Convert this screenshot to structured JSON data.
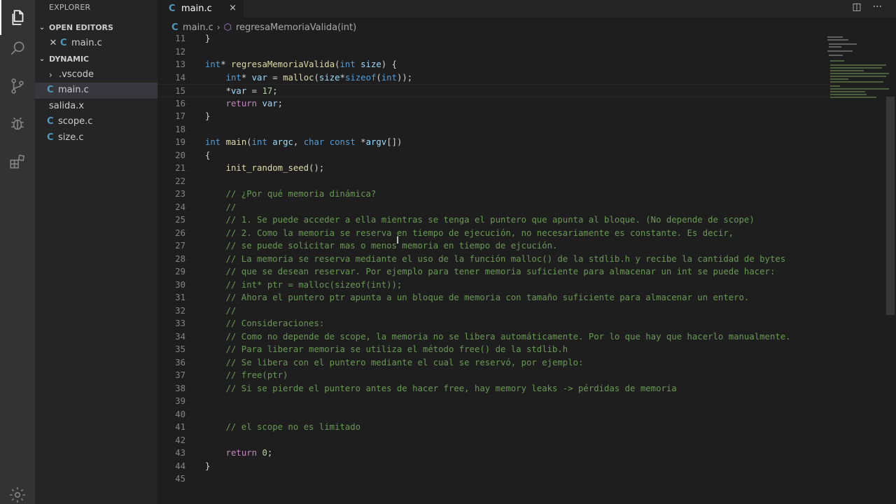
{
  "sidebar": {
    "title": "EXPLORER",
    "open_editors_label": "OPEN EDITORS",
    "open_editor_file": "main.c",
    "folder_label": "DYNAMIC",
    "files": [
      {
        "name": ".vscode",
        "type": "folder"
      },
      {
        "name": "main.c",
        "type": "c"
      },
      {
        "name": "salida.x",
        "type": "file"
      },
      {
        "name": "scope.c",
        "type": "c"
      },
      {
        "name": "size.c",
        "type": "c"
      }
    ]
  },
  "tab": {
    "label": "main.c",
    "close": "×"
  },
  "breadcrumb": {
    "file": "main.c",
    "symbol": "regresaMemoriaValida(int)"
  },
  "editor": {
    "line_numbers": [
      "11",
      "12",
      "13",
      "14",
      "15",
      "16",
      "17",
      "18",
      "19",
      "20",
      "21",
      "22",
      "23",
      "24",
      "25",
      "26",
      "27",
      "28",
      "29",
      "30",
      "31",
      "32",
      "33",
      "34",
      "35",
      "36",
      "37",
      "38",
      "39",
      "40",
      "41",
      "42",
      "43",
      "44",
      "45"
    ],
    "comments": {
      "c23": "// ¿Por qué memoria dinámica?",
      "c24": "//",
      "c25": "// 1. Se puede acceder a ella mientras se tenga el puntero que apunta al bloque. (No depende de scope)",
      "c26": "// 2. Como la memoria se reserva en tiempo de ejecución, no necesariamente es constante. Es decir,",
      "c27": "// se puede solicitar mas o menos memoria en tiempo de ejcución.",
      "c28": "// La memoria se reserva mediante el uso de la función malloc() de la stdlib.h y recibe la cantidad de bytes",
      "c29": "// que se desean reservar. Por ejemplo para tener memoria suficiente para almacenar un int se puede hacer:",
      "c30": "// int* ptr = malloc(sizeof(int));",
      "c31": "// Ahora el puntero ptr apunta a un bloque de memoria con tamaño suficiente para almacenar un entero.",
      "c32": "//",
      "c33": "// Consideraciones:",
      "c34": "// Como no depende de scope, la memoria no se libera automáticamente. Por lo que hay que hacerlo manualmente.",
      "c35": "// Para liberar memoria se utiliza el método free() de la stdlib.h",
      "c36": "// Se libera con el puntero mediante el cual se reservó, por ejemplo:",
      "c37": "// free(ptr)",
      "c38": "// Si se pierde el puntero antes de hacer free, hay memory leaks -> pérdidas de memoria",
      "c41": "// el scope no es limitado"
    }
  }
}
